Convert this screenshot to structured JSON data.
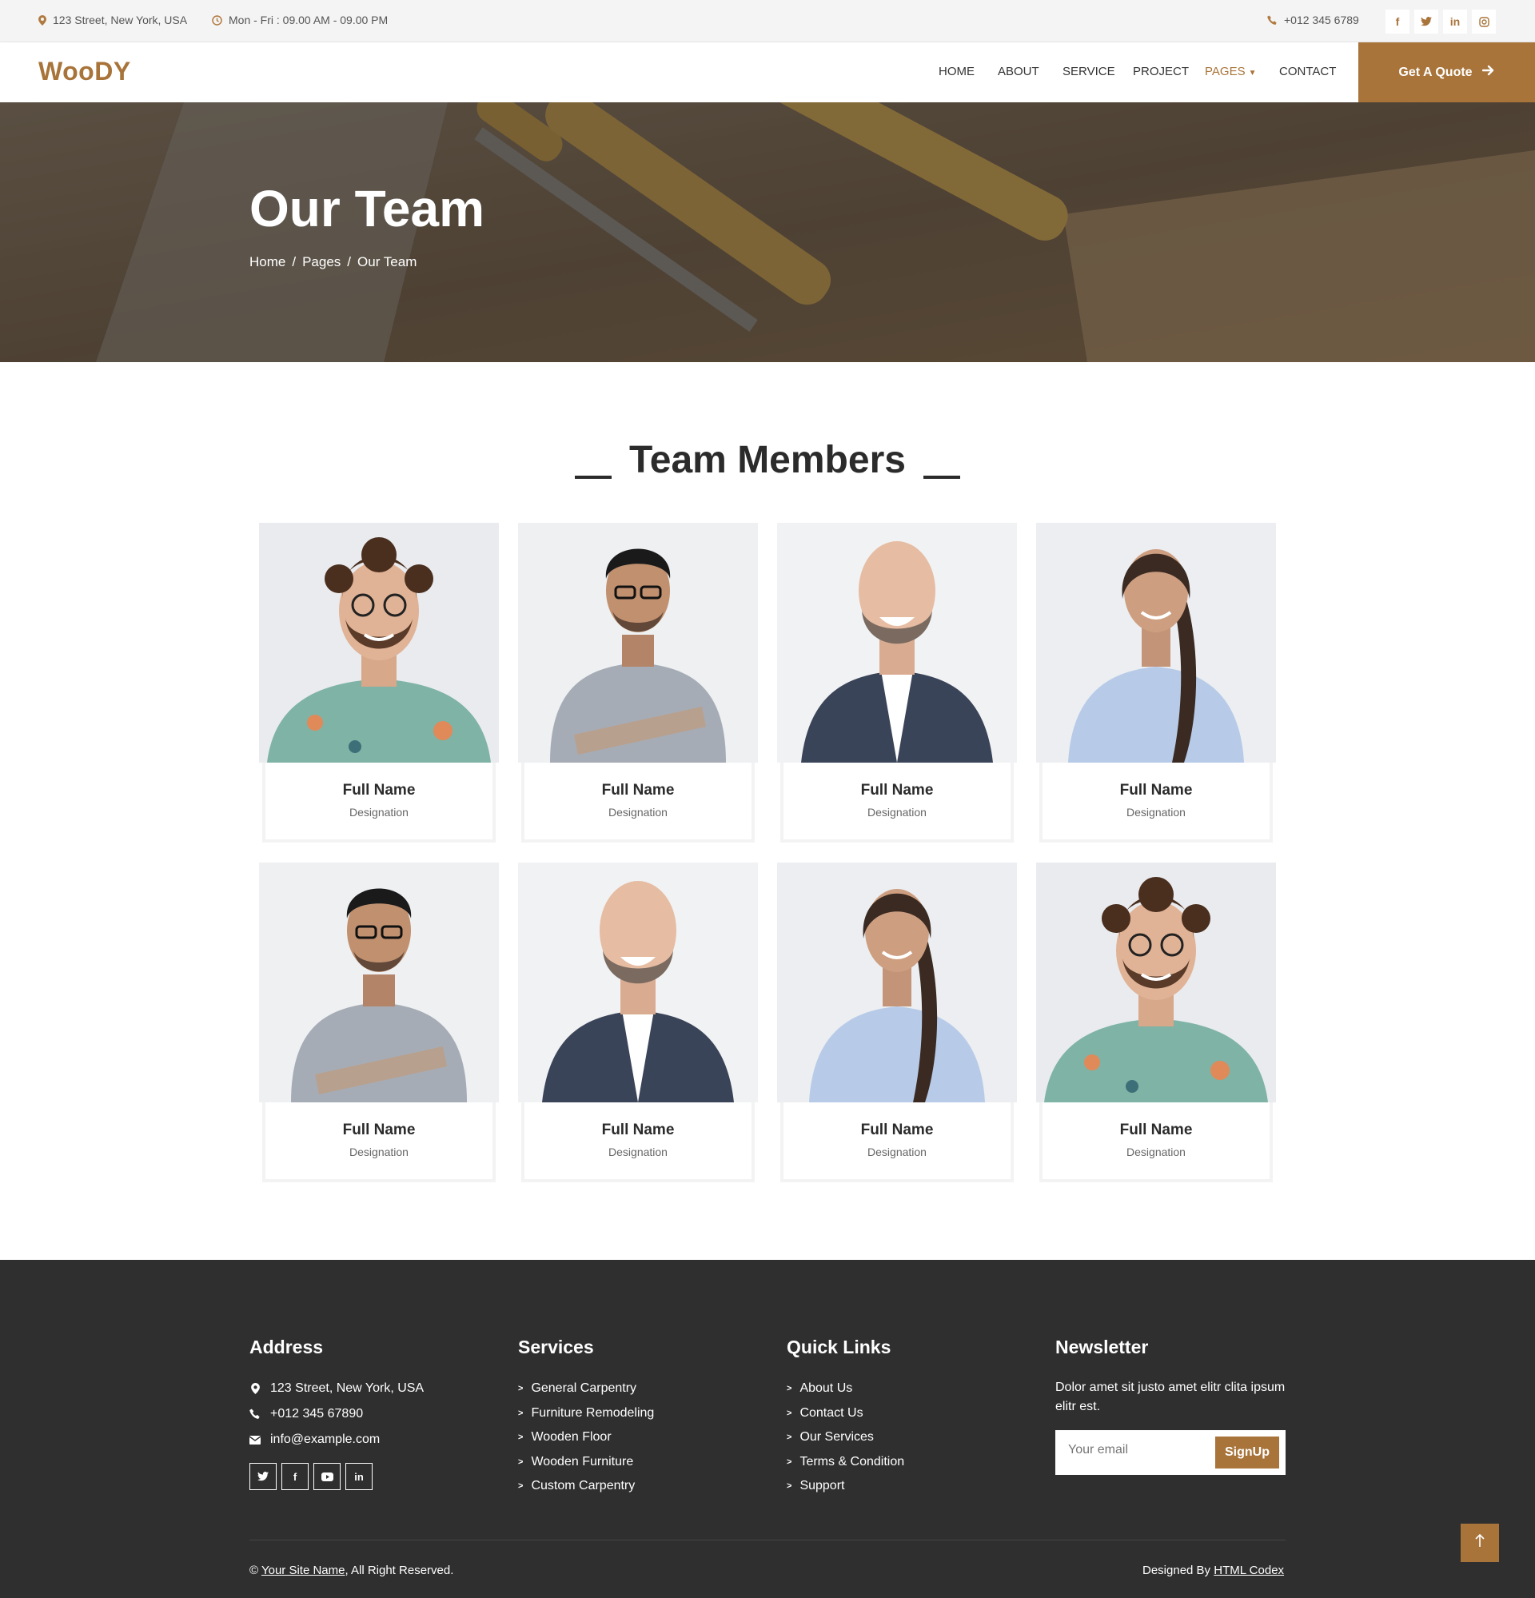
{
  "topbar": {
    "address": "123 Street, New York, USA",
    "hours": "Mon - Fri : 09.00 AM - 09.00 PM",
    "phone": "+012 345 6789",
    "socials": [
      {
        "icon": "facebook-icon",
        "glyph": "f"
      },
      {
        "icon": "twitter-icon",
        "glyph": "t"
      },
      {
        "icon": "linkedin-icon",
        "glyph": "in"
      },
      {
        "icon": "instagram-icon",
        "glyph": "◎"
      }
    ]
  },
  "navbar": {
    "brand": "WooDY",
    "links": [
      "HOME",
      "ABOUT",
      "SERVICE",
      "PROJECT",
      "PAGES",
      "CONTACT"
    ],
    "active": "PAGES",
    "cta": "Get A Quote"
  },
  "hero": {
    "title": "Our Team",
    "breadcrumb": [
      "Home",
      "/",
      "Pages",
      "/",
      "Our Team"
    ]
  },
  "team": {
    "title": "Team Members",
    "members": [
      {
        "name": "Full Name",
        "designation": "Designation"
      },
      {
        "name": "Full Name",
        "designation": "Designation"
      },
      {
        "name": "Full Name",
        "designation": "Designation"
      },
      {
        "name": "Full Name",
        "designation": "Designation"
      },
      {
        "name": "Full Name",
        "designation": "Designation"
      },
      {
        "name": "Full Name",
        "designation": "Designation"
      },
      {
        "name": "Full Name",
        "designation": "Designation"
      },
      {
        "name": "Full Name",
        "designation": "Designation"
      }
    ]
  },
  "footer": {
    "address": {
      "title": "Address",
      "lines": [
        "123 Street, New York, USA",
        "+012 345 67890",
        "info@example.com"
      ],
      "socials": [
        "twitter-icon",
        "facebook-icon",
        "youtube-icon",
        "linkedin-icon"
      ]
    },
    "services": {
      "title": "Services",
      "links": [
        "General Carpentry",
        "Furniture Remodeling",
        "Wooden Floor",
        "Wooden Furniture",
        "Custom Carpentry"
      ]
    },
    "quick_links": {
      "title": "Quick Links",
      "links": [
        "About Us",
        "Contact Us",
        "Our Services",
        "Terms & Condition",
        "Support"
      ]
    },
    "newsletter": {
      "title": "Newsletter",
      "text": "Dolor amet sit justo amet elitr clita ipsum elitr est.",
      "placeholder": "Your email",
      "button": "SignUp"
    },
    "copyright_prefix": "©",
    "site_name": "Your Site Name",
    "copyright_suffix": ", All Right Reserved.",
    "designed_prefix": "Designed By",
    "designer": "HTML Codex"
  },
  "colors": {
    "accent": "#a8743a",
    "footer_bg": "#2f2f2f",
    "topbar_bg": "#f4f4f4"
  }
}
